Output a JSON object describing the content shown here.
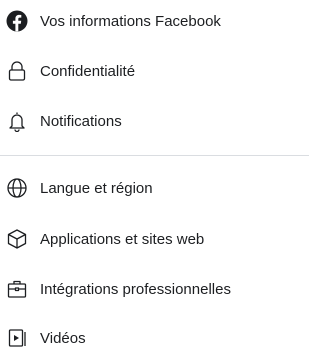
{
  "settings_menu": {
    "items": [
      {
        "label": "Vos informations Facebook",
        "icon": "facebook-logo-icon"
      },
      {
        "label": "Confidentialité",
        "icon": "lock-icon"
      },
      {
        "label": "Notifications",
        "icon": "bell-icon"
      },
      {
        "label": "Langue et région",
        "icon": "globe-icon"
      },
      {
        "label": "Applications et sites web",
        "icon": "cube-icon"
      },
      {
        "label": "Intégrations professionnelles",
        "icon": "briefcase-icon"
      },
      {
        "label": "Vidéos",
        "icon": "video-play-icon"
      }
    ]
  },
  "colors": {
    "text": "#1c1e21",
    "divider": "#dadde1",
    "facebook_icon": "#1c1e21"
  }
}
